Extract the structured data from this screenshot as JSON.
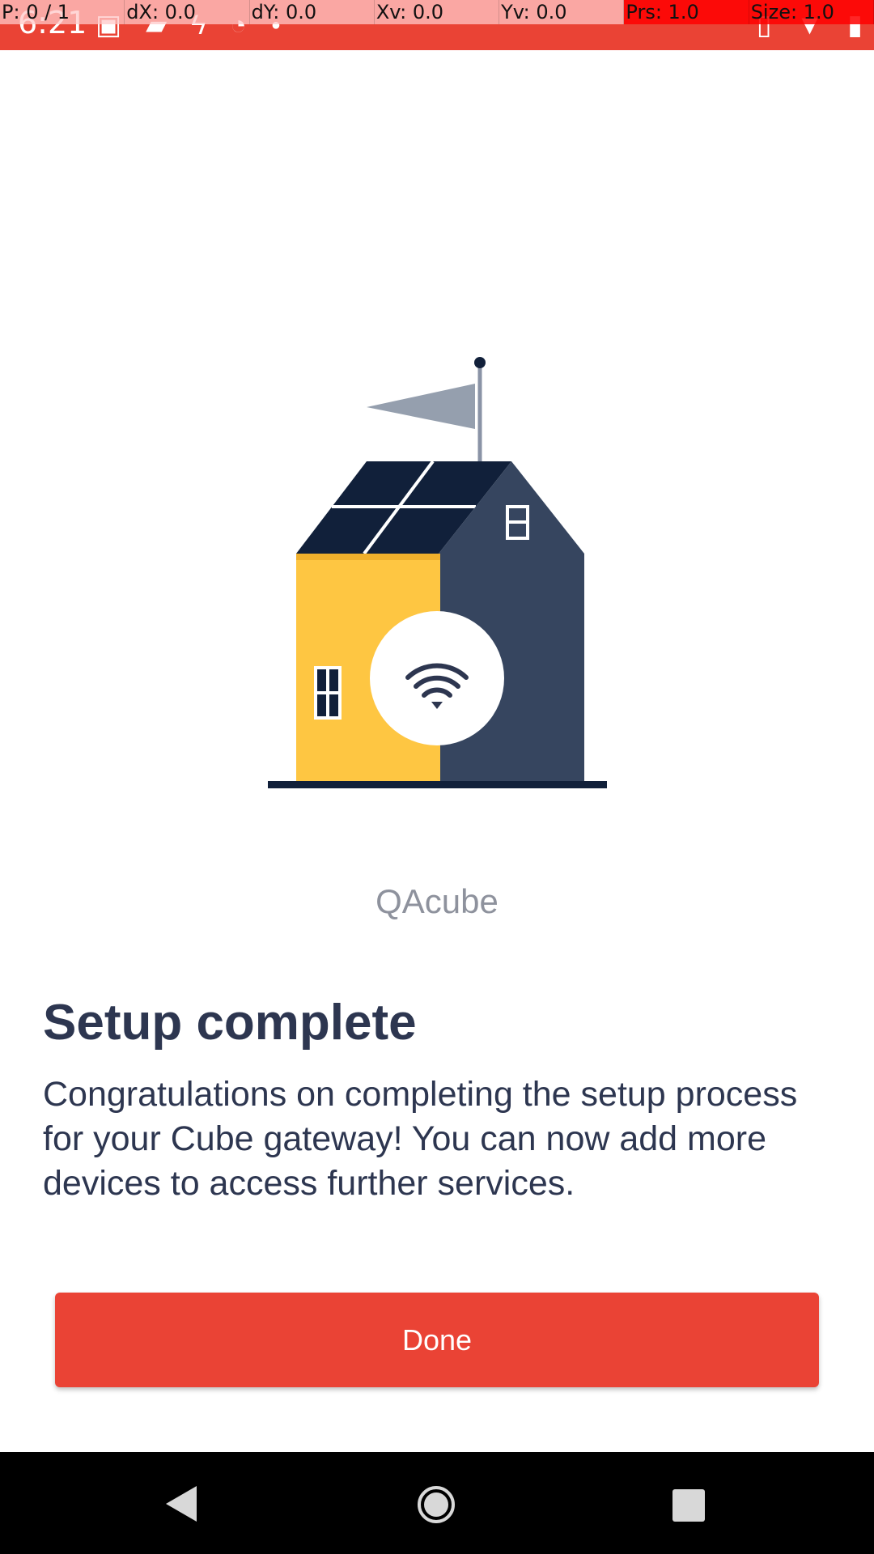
{
  "status_bar": {
    "time": "6:21",
    "left_icons": [
      "image-icon",
      "chat-icon",
      "flash-icon",
      "sync-icon",
      "dot-icon"
    ],
    "right_icons": [
      "vibrate-icon",
      "wifi-icon",
      "battery-icon"
    ]
  },
  "debug_overlay": {
    "pointer": "P: 0 / 1",
    "dx": "dX: 0.0",
    "dy": "dY: 0.0",
    "xv": "Xv: 0.0",
    "yv": "Yv: 0.0",
    "prs": "Prs: 1.0",
    "size": "Size: 1.0"
  },
  "colors": {
    "accent": "#ea4335",
    "text_dark": "#2d3650",
    "text_muted": "#8e929d",
    "house_yellow": "#fec642",
    "house_navy": "#36455f",
    "roof_dark": "#11203a",
    "flag_gray": "#959fae"
  },
  "device": {
    "name": "QAcube"
  },
  "content": {
    "title": "Setup complete",
    "description": "Congratulations on completing the setup process for your Cube gateway! You can now add more devices to access further services."
  },
  "actions": {
    "done_label": "Done"
  },
  "navigation": {
    "back": "back-icon",
    "home": "home-icon",
    "recents": "recents-icon"
  }
}
